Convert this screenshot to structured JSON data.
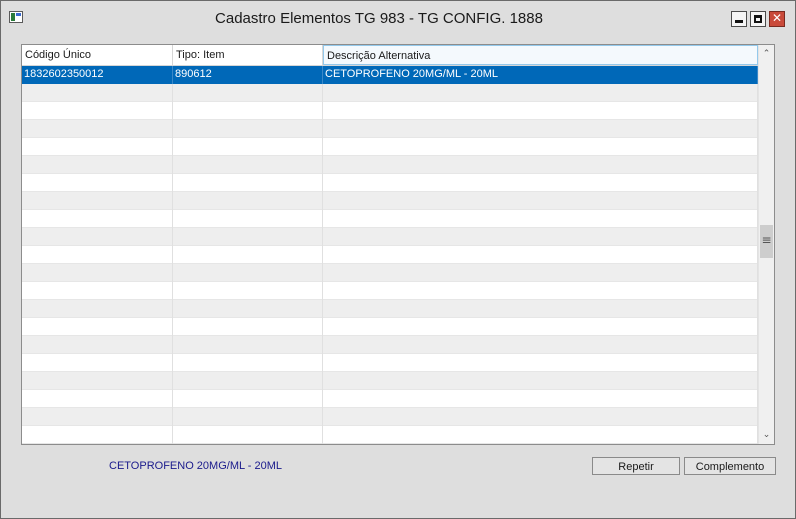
{
  "window": {
    "title": "Cadastro Elementos TG 983 - TG CONFIG. 1888",
    "controls": {
      "minimize_icon": "minimize-icon",
      "maximize_icon": "maximize-icon",
      "close_icon": "close-icon",
      "close_glyph": "✕"
    }
  },
  "grid": {
    "columns": [
      "Código Único",
      "Tipo: Item",
      "Descrição Alternativa"
    ],
    "rows": [
      {
        "codigo": "1832602350012",
        "tipo": "890612",
        "descricao": "CETOPROFENO 20MG/ML - 20ML",
        "selected": true
      },
      {
        "codigo": "",
        "tipo": "",
        "descricao": ""
      },
      {
        "codigo": "",
        "tipo": "",
        "descricao": ""
      },
      {
        "codigo": "",
        "tipo": "",
        "descricao": ""
      },
      {
        "codigo": "",
        "tipo": "",
        "descricao": ""
      },
      {
        "codigo": "",
        "tipo": "",
        "descricao": ""
      },
      {
        "codigo": "",
        "tipo": "",
        "descricao": ""
      },
      {
        "codigo": "",
        "tipo": "",
        "descricao": ""
      },
      {
        "codigo": "",
        "tipo": "",
        "descricao": ""
      },
      {
        "codigo": "",
        "tipo": "",
        "descricao": ""
      },
      {
        "codigo": "",
        "tipo": "",
        "descricao": ""
      },
      {
        "codigo": "",
        "tipo": "",
        "descricao": ""
      },
      {
        "codigo": "",
        "tipo": "",
        "descricao": ""
      },
      {
        "codigo": "",
        "tipo": "",
        "descricao": ""
      },
      {
        "codigo": "",
        "tipo": "",
        "descricao": ""
      },
      {
        "codigo": "",
        "tipo": "",
        "descricao": ""
      },
      {
        "codigo": "",
        "tipo": "",
        "descricao": ""
      },
      {
        "codigo": "",
        "tipo": "",
        "descricao": ""
      },
      {
        "codigo": "",
        "tipo": "",
        "descricao": ""
      },
      {
        "codigo": "",
        "tipo": "",
        "descricao": ""
      },
      {
        "codigo": "",
        "tipo": "",
        "descricao": ""
      },
      {
        "codigo": "",
        "tipo": "",
        "descricao": ""
      }
    ],
    "scrollbar": {
      "up_glyph": "⌃",
      "down_glyph": "⌄"
    }
  },
  "footer": {
    "selected_description": "CETOPROFENO 20MG/ML - 20ML",
    "repetir_label": "Repetir",
    "complemento_label": "Complemento"
  },
  "colors": {
    "selection": "#0068b8",
    "status_text": "#1a1a8c",
    "close_button": "#c94a3a"
  }
}
